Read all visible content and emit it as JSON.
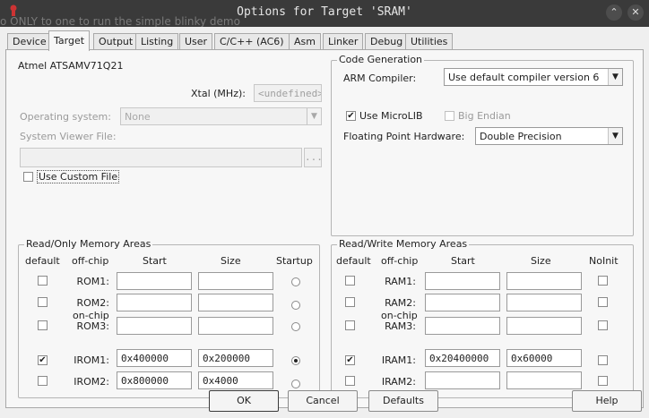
{
  "window": {
    "title": "Options for Target 'SRAM'",
    "background_text": "o ONLY to one to run the simple blinky demo"
  },
  "tabs": [
    "Device",
    "Target",
    "Output",
    "Listing",
    "User",
    "C/C++ (AC6)",
    "Asm",
    "Linker",
    "Debug",
    "Utilities"
  ],
  "active_tab": "Target",
  "target": {
    "device": "Atmel ATSAMV71Q21",
    "xtal_label": "Xtal (MHz):",
    "xtal_value": "<undefined>",
    "os_label": "Operating system:",
    "os_value": "None",
    "sysviewer_label": "System Viewer File:",
    "sysviewer_value": "",
    "browse_label": "...",
    "use_custom_file": "Use Custom File"
  },
  "codegen": {
    "title": "Code Generation",
    "compiler_label": "ARM Compiler:",
    "compiler_value": "Use default compiler version 6",
    "use_microlib": "Use MicroLIB",
    "use_microlib_checked": true,
    "big_endian": "Big Endian",
    "fp_label": "Floating Point Hardware:",
    "fp_value": "Double Precision"
  },
  "ro_memory": {
    "title": "Read/Only Memory Areas",
    "headers": {
      "default": "default",
      "offchip": "off-chip",
      "start": "Start",
      "size": "Size",
      "startup": "Startup"
    },
    "onchip_label": "on-chip",
    "rows": [
      {
        "label": "ROM1:",
        "start": "",
        "size": "",
        "default": false,
        "startup": false
      },
      {
        "label": "ROM2:",
        "start": "",
        "size": "",
        "default": false,
        "startup": false
      },
      {
        "label": "ROM3:",
        "start": "",
        "size": "",
        "default": false,
        "startup": false
      },
      {
        "label": "IROM1:",
        "start": "0x400000",
        "size": "0x200000",
        "default": true,
        "startup": true
      },
      {
        "label": "IROM2:",
        "start": "0x800000",
        "size": "0x4000",
        "default": false,
        "startup": false
      }
    ]
  },
  "rw_memory": {
    "title": "Read/Write Memory Areas",
    "headers": {
      "default": "default",
      "offchip": "off-chip",
      "start": "Start",
      "size": "Size",
      "noinit": "NoInit"
    },
    "onchip_label": "on-chip",
    "rows": [
      {
        "label": "RAM1:",
        "start": "",
        "size": "",
        "default": false,
        "noinit": false
      },
      {
        "label": "RAM2:",
        "start": "",
        "size": "",
        "default": false,
        "noinit": false
      },
      {
        "label": "RAM3:",
        "start": "",
        "size": "",
        "default": false,
        "noinit": false
      },
      {
        "label": "IRAM1:",
        "start": "0x20400000",
        "size": "0x60000",
        "default": true,
        "noinit": false
      },
      {
        "label": "IRAM2:",
        "start": "",
        "size": "",
        "default": false,
        "noinit": false
      }
    ]
  },
  "buttons": {
    "ok": "OK",
    "cancel": "Cancel",
    "defaults": "Defaults",
    "help": "Help"
  },
  "check_mark": "✔",
  "dropdown_arrow": "▼",
  "window_close": "✕",
  "window_minimize": "⌃"
}
